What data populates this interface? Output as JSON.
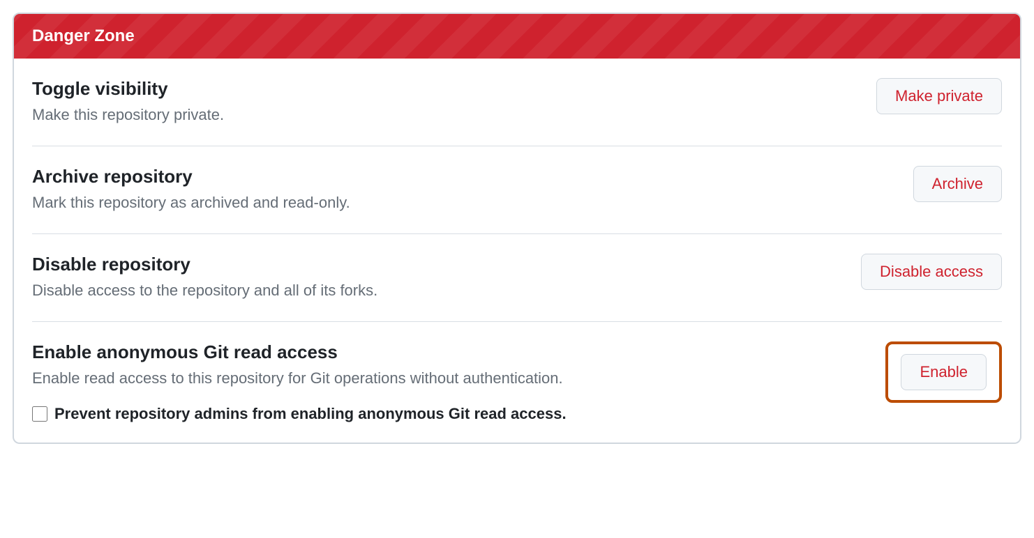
{
  "header": {
    "title": "Danger Zone"
  },
  "rows": [
    {
      "title": "Toggle visibility",
      "desc": "Make this repository private.",
      "button": "Make private"
    },
    {
      "title": "Archive repository",
      "desc": "Mark this repository as archived and read-only.",
      "button": "Archive"
    },
    {
      "title": "Disable repository",
      "desc": "Disable access to the repository and all of its forks.",
      "button": "Disable access"
    },
    {
      "title": "Enable anonymous Git read access",
      "desc": "Enable read access to this repository for Git operations without authentication.",
      "button": "Enable",
      "checkbox_label": "Prevent repository admins from enabling anonymous Git read access."
    }
  ]
}
